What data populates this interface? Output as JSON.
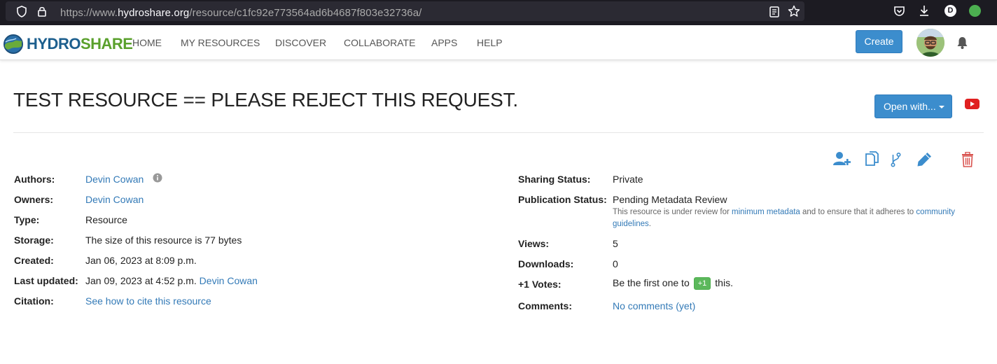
{
  "browser": {
    "url_prefix": "https://www.",
    "url_host": "hydroshare.org",
    "url_path": "/resource/c1fc92e773564ad6b4687f803e32736a/",
    "profile_letter": "D"
  },
  "navbar": {
    "logo_part1": "HYDRO",
    "logo_part2": "SHARE",
    "items": [
      {
        "label": "HOME"
      },
      {
        "label": "MY RESOURCES"
      },
      {
        "label": "DISCOVER"
      },
      {
        "label": "COLLABORATE"
      },
      {
        "label": "APPS"
      },
      {
        "label": "HELP"
      }
    ],
    "create_label": "Create"
  },
  "resource": {
    "title": "TEST RESOURCE == PLEASE REJECT THIS REQUEST.",
    "open_with_label": "Open with..."
  },
  "left_fields": {
    "authors_label": "Authors:",
    "authors_value": "Devin Cowan",
    "owners_label": "Owners:",
    "owners_value": "Devin Cowan",
    "type_label": "Type:",
    "type_value": "Resource",
    "storage_label": "Storage:",
    "storage_value": "The size of this resource is 77 bytes",
    "created_label": "Created:",
    "created_value": "Jan 06, 2023 at 8:09 p.m.",
    "updated_label": "Last updated:",
    "updated_value": "Jan 09, 2023 at 4:52 p.m.",
    "updated_by": "Devin Cowan",
    "citation_label": "Citation:",
    "citation_value": "See how to cite this resource"
  },
  "right_fields": {
    "sharing_label": "Sharing Status:",
    "sharing_value": "Private",
    "publication_label": "Publication Status:",
    "publication_value": "Pending Metadata Review",
    "publication_note_1": "This resource is under review for",
    "publication_note_link1": "minimum metadata",
    "publication_note_2": "and to ensure that it adheres to",
    "publication_note_link2a": "community",
    "publication_note_link2b": "guidelines",
    "publication_note_end": ".",
    "views_label": "Views:",
    "views_value": "5",
    "downloads_label": "Downloads:",
    "downloads_value": "0",
    "votes_label": "+1 Votes:",
    "votes_pre": "Be the first one to",
    "votes_badge": "+1",
    "votes_post": "this.",
    "comments_label": "Comments:",
    "comments_value": "No comments (yet)"
  },
  "colors": {
    "accent": "#3c8dcd",
    "link": "#337ab7",
    "danger": "#d9534f",
    "success": "#5cb85c"
  },
  "icons": [
    "add-author-icon",
    "copy-resource-icon",
    "new-version-icon",
    "edit-icon",
    "delete-icon",
    "youtube-icon",
    "bell-icon",
    "info-icon"
  ]
}
